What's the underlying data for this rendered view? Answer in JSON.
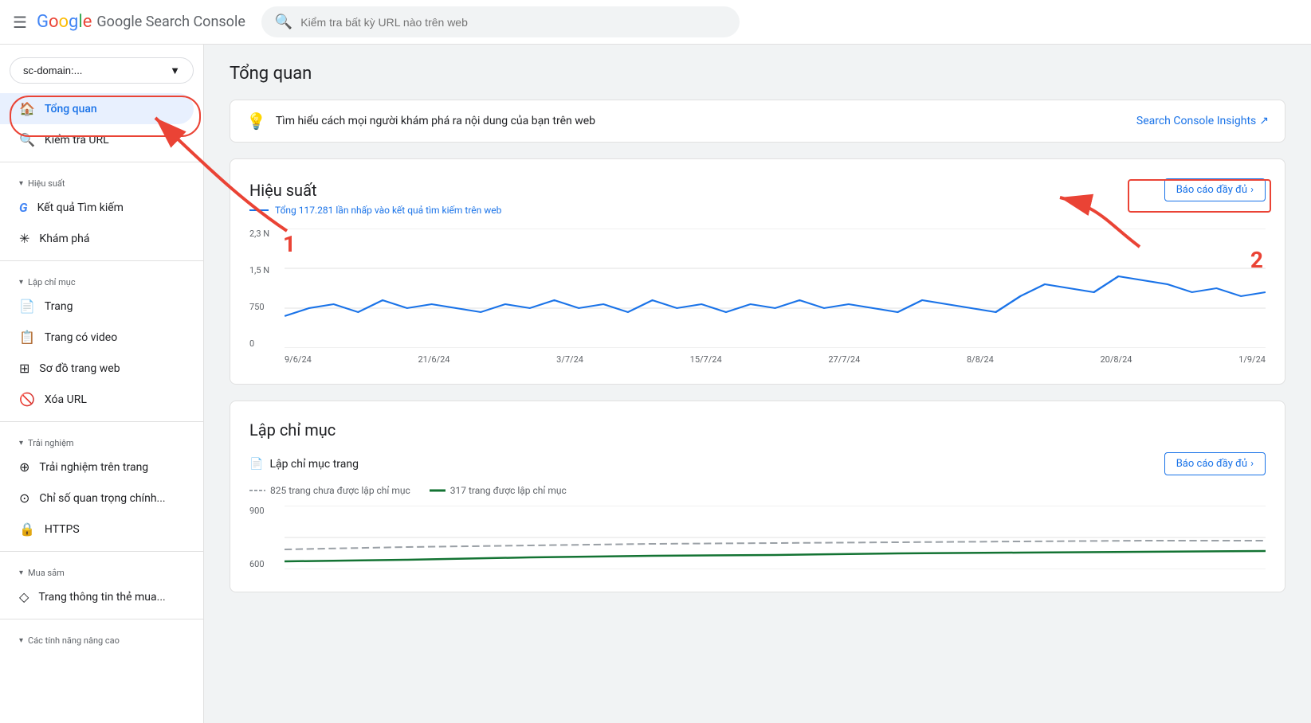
{
  "app": {
    "name": "Google Search Console",
    "google_text": "Google",
    "search_placeholder": "Kiểm tra bất kỳ URL nào trên web"
  },
  "sidebar": {
    "property_btn": "sc-domain:...",
    "items": [
      {
        "id": "tong-quan",
        "label": "Tổng quan",
        "icon": "🏠",
        "active": true,
        "section": null
      },
      {
        "id": "kiem-tra-url",
        "label": "Kiểm tra URL",
        "icon": "🔍",
        "active": false,
        "section": null
      },
      {
        "id": "section-hieu-suat",
        "label": "Hiệu suất",
        "type": "section"
      },
      {
        "id": "ket-qua-tim-kiem",
        "label": "Kết quả Tìm kiếm",
        "icon": "G",
        "active": false,
        "section": "Hiệu suất"
      },
      {
        "id": "kham-pha",
        "label": "Khám phá",
        "icon": "✳",
        "active": false,
        "section": "Hiệu suất"
      },
      {
        "id": "section-lap-chi-muc",
        "label": "Lập chỉ mục",
        "type": "section"
      },
      {
        "id": "trang",
        "label": "Trang",
        "icon": "📄",
        "active": false,
        "section": "Lập chỉ mục"
      },
      {
        "id": "trang-co-video",
        "label": "Trang có video",
        "icon": "📋",
        "active": false,
        "section": "Lập chỉ mục"
      },
      {
        "id": "so-do-trang-web",
        "label": "Sơ đồ trang web",
        "icon": "⊞",
        "active": false,
        "section": "Lập chỉ mục"
      },
      {
        "id": "xoa-url",
        "label": "Xóa URL",
        "icon": "🚫",
        "active": false,
        "section": "Lập chỉ mục"
      },
      {
        "id": "section-trai-nghiem",
        "label": "Trải nghiệm",
        "type": "section"
      },
      {
        "id": "trai-nghiem-tren-trang",
        "label": "Trải nghiệm trên trang",
        "icon": "⊕",
        "active": false,
        "section": "Trải nghiệm"
      },
      {
        "id": "chi-so-quan-trong",
        "label": "Chỉ số quan trọng chính...",
        "icon": "⊙",
        "active": false,
        "section": "Trải nghiệm"
      },
      {
        "id": "https",
        "label": "HTTPS",
        "icon": "🔒",
        "active": false,
        "section": "Trải nghiệm"
      },
      {
        "id": "section-mua-sam",
        "label": "Mua sắm",
        "type": "section"
      },
      {
        "id": "trang-thong-tin",
        "label": "Trang thông tin thẻ mua...",
        "icon": "◇",
        "active": false,
        "section": "Mua sắm"
      },
      {
        "id": "section-cac-tinh-nang",
        "label": "Các tính năng nâng cao",
        "type": "section"
      }
    ]
  },
  "main": {
    "page_title": "Tổng quan",
    "info_banner": {
      "text": "Tìm hiểu cách mọi người khám phá ra nội dung của bạn trên web",
      "link_label": "Search Console Insights",
      "link_icon": "↗"
    },
    "performance": {
      "title": "Hiệu suất",
      "report_link": "Báo cáo đầy đủ",
      "subtitle": "Tổng 117.281 lần nhấp vào kết quả tìm kiếm trên web",
      "y_labels": [
        "2,3 N",
        "1,5 N",
        "750",
        "0"
      ],
      "x_labels": [
        "9/6/24",
        "21/6/24",
        "3/7/24",
        "15/7/24",
        "27/7/24",
        "8/8/24",
        "20/8/24",
        "1/9/24"
      ],
      "chart_color": "#1a73e8"
    },
    "indexing": {
      "title": "Lập chỉ mục",
      "sub_header": "Lập chỉ mục trang",
      "report_link": "Báo cáo đầy đủ",
      "legend": [
        {
          "label": "825 trang chưa được lập chỉ mục",
          "color": "#9aa0a6",
          "dashed": true
        },
        {
          "label": "317 trang được lập chỉ mục",
          "color": "#137333",
          "dashed": false
        }
      ],
      "y_labels": [
        "900",
        "600"
      ]
    }
  },
  "annotations": {
    "arrow1_label": "1",
    "arrow2_label": "2"
  }
}
